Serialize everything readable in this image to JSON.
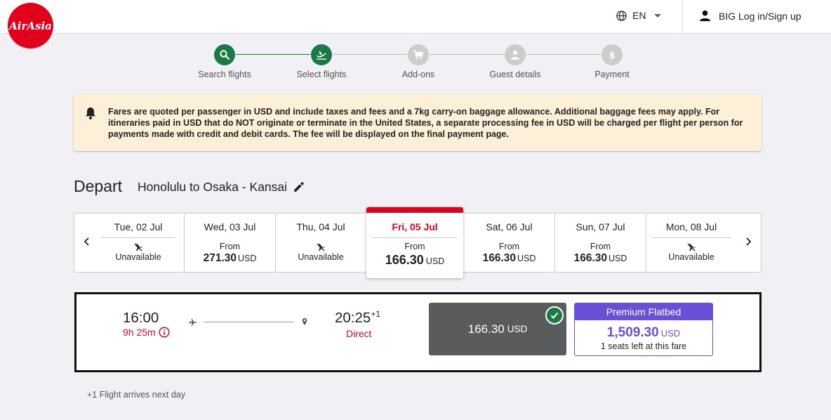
{
  "header": {
    "logo_text": "AirAsia",
    "language": "EN",
    "login_label": "BIG Log in/Sign up"
  },
  "stepper": {
    "steps": [
      {
        "label": "Search flights",
        "icon": "search-icon",
        "state": "done"
      },
      {
        "label": "Select flights",
        "icon": "plane-takeoff-icon",
        "state": "current"
      },
      {
        "label": "Add-ons",
        "icon": "cart-icon",
        "state": "pending"
      },
      {
        "label": "Guest details",
        "icon": "person-icon",
        "state": "pending"
      },
      {
        "label": "Payment",
        "icon": "dollar-icon",
        "state": "pending"
      }
    ]
  },
  "notice": {
    "text": "Fares are quoted per passenger in USD and include taxes and fees and a 7kg carry-on baggage allowance. Additional baggage fees may apply. For itineraries paid in USD that do NOT originate or terminate in the United States, a separate processing fee in USD will be charged per flight per person for payments made with credit and debit cards. The fee will be displayed on the final payment page."
  },
  "depart": {
    "title": "Depart",
    "route": "Honolulu to Osaka - Kansai"
  },
  "dates": [
    {
      "label": "Tue, 02 Jul",
      "available": false,
      "status": "Unavailable"
    },
    {
      "label": "Wed, 03 Jul",
      "available": true,
      "from": "From",
      "price": "271.30",
      "currency": "USD"
    },
    {
      "label": "Thu, 04 Jul",
      "available": false,
      "status": "Unavailable"
    },
    {
      "label": "Fri, 05 Jul",
      "available": true,
      "from": "From",
      "price": "166.30",
      "currency": "USD",
      "selected": true
    },
    {
      "label": "Sat, 06 Jul",
      "available": true,
      "from": "From",
      "price": "166.30",
      "currency": "USD"
    },
    {
      "label": "Sun, 07 Jul",
      "available": true,
      "from": "From",
      "price": "166.30",
      "currency": "USD"
    },
    {
      "label": "Mon, 08 Jul",
      "available": false,
      "status": "Unavailable"
    }
  ],
  "flight": {
    "depart_time": "16:00",
    "duration": "9h 25m",
    "arrive_time": "20:25",
    "arrive_offset": "+1",
    "stops": "Direct",
    "selected_fare": {
      "price": "166.30",
      "currency": "USD"
    },
    "premium": {
      "title": "Premium Flatbed",
      "price": "1,509.30",
      "currency": "USD",
      "seats_left": "1 seats left at this fare"
    }
  },
  "footnote": "+1 Flight arrives next day",
  "colors": {
    "brand_red": "#e3001b",
    "step_green": "#1a7a44",
    "premium_purple": "#6b4fd8",
    "notice_bg": "#fdf0d8"
  }
}
